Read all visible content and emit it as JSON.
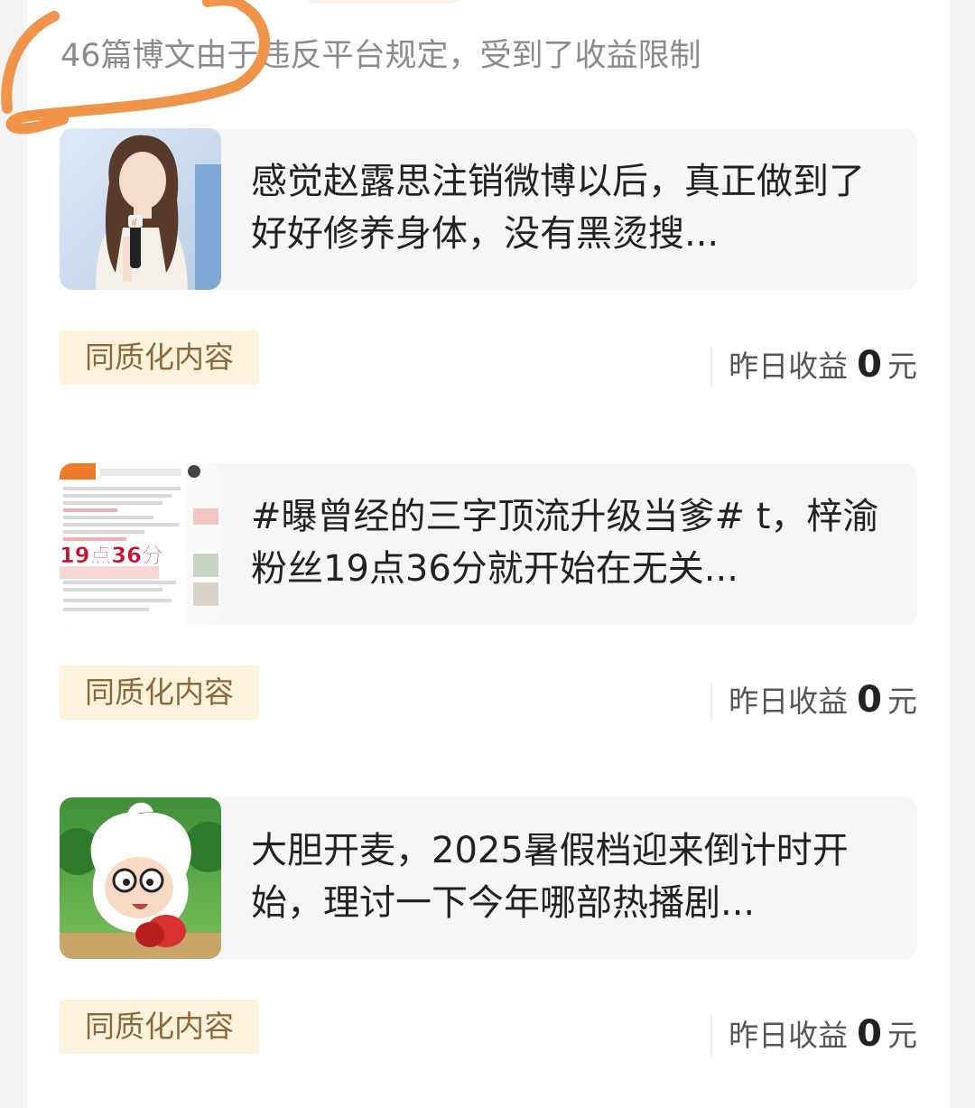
{
  "notice": "46篇博文由于违反平台规定，受到了收益限制",
  "posts": [
    {
      "title": "感觉赵露思注销微博以后，真正做到了好好修养身体，没有黑烫搜...",
      "thumb_icon": "woman-with-microphone-photo",
      "tag": "同质化内容",
      "earnings_label": "昨日收益",
      "earnings_value": "0",
      "earnings_unit": "元"
    },
    {
      "title": "#曝曾经的三字顶流升级当爹# t，梓渝粉丝19点36分就开始在无关...",
      "thumb_icon": "weibo-screenshot-thumbnail",
      "thumb_text": "19点36分",
      "tag": "同质化内容",
      "earnings_label": "昨日收益",
      "earnings_value": "0",
      "earnings_unit": "元"
    },
    {
      "title": "大胆开麦，2025暑假档迎来倒计时开始，理讨一下今年哪部热播剧...",
      "thumb_icon": "cartoon-sheep-avatar",
      "tag": "同质化内容",
      "earnings_label": "昨日收益",
      "earnings_value": "0",
      "earnings_unit": "元"
    }
  ],
  "colors": {
    "tag_bg": "#fdf3dd",
    "tag_text": "#8a6a3a",
    "annotation": "#f0944a",
    "card_bg": "#f6f6f6"
  }
}
